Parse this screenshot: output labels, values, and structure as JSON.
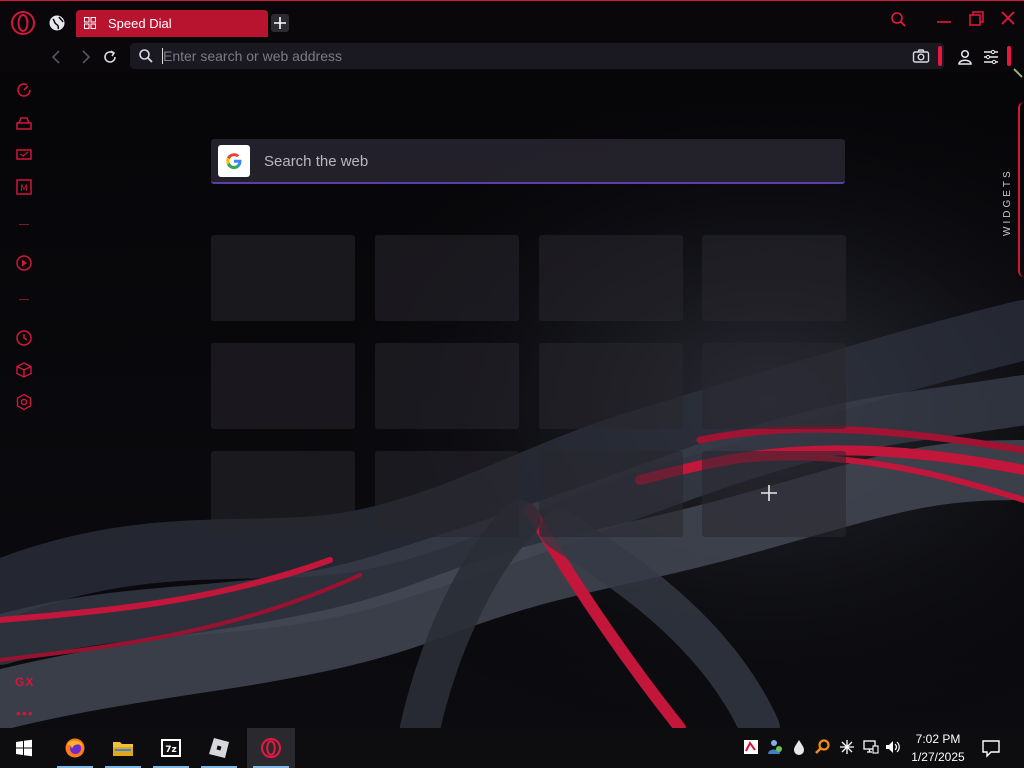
{
  "browser": {
    "tab_title": "Speed Dial",
    "address_placeholder": "Enter search or web address"
  },
  "speed_dial": {
    "search_placeholder": "Search the web"
  },
  "sidebar": {
    "gx_label": "GX",
    "more_label": "•••"
  },
  "widgets_label": "WIDGETS",
  "taskbar": {
    "time": "7:02 PM",
    "date": "1/27/2025",
    "apps": [
      "firefox-icon",
      "file-explorer-icon",
      "7zip-icon",
      "roblox-icon",
      "opera-gx-icon"
    ]
  },
  "colors": {
    "accent": "#d1173b",
    "tab": "#b8142f",
    "background": "#050407",
    "search_underline": "#5a3fa8"
  }
}
